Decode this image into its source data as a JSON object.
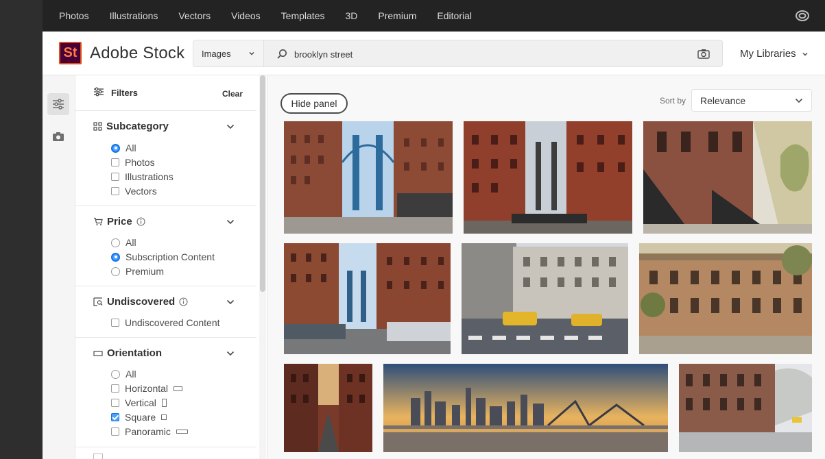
{
  "topnav": {
    "items": [
      "Photos",
      "Illustrations",
      "Vectors",
      "Videos",
      "Templates",
      "3D",
      "Premium",
      "Editorial"
    ],
    "right_icon": "creative-cloud-icon"
  },
  "header": {
    "logo_text": "St",
    "brand": "Adobe Stock",
    "asset_type": "Images",
    "search_value": "brooklyn street",
    "my_libraries": "My Libraries"
  },
  "filters": {
    "title": "Filters",
    "clear": "Clear",
    "sections": {
      "subcategory": {
        "title": "Subcategory",
        "options": [
          {
            "label": "All",
            "control": "radio",
            "selected": true
          },
          {
            "label": "Photos",
            "control": "checkbox",
            "selected": false
          },
          {
            "label": "Illustrations",
            "control": "checkbox",
            "selected": false
          },
          {
            "label": "Vectors",
            "control": "checkbox",
            "selected": false
          }
        ]
      },
      "price": {
        "title": "Price",
        "options": [
          {
            "label": "All",
            "control": "radio",
            "selected": false
          },
          {
            "label": "Subscription Content",
            "control": "radio",
            "selected": true
          },
          {
            "label": "Premium",
            "control": "radio",
            "selected": false
          }
        ]
      },
      "undiscovered": {
        "title": "Undiscovered",
        "options": [
          {
            "label": "Undiscovered Content",
            "control": "checkbox",
            "selected": false
          }
        ]
      },
      "orientation": {
        "title": "Orientation",
        "options": [
          {
            "label": "All",
            "control": "radio",
            "selected": false
          },
          {
            "label": "Horizontal",
            "control": "checkbox",
            "selected": false
          },
          {
            "label": "Vertical",
            "control": "checkbox",
            "selected": false
          },
          {
            "label": "Square",
            "control": "checkbox",
            "selected": true
          },
          {
            "label": "Panoramic",
            "control": "checkbox",
            "selected": false
          }
        ]
      }
    }
  },
  "results": {
    "hide_panel": "Hide panel",
    "sort_label": "Sort by",
    "sort_value": "Relevance"
  },
  "colors": {
    "topnav_bg": "#232323",
    "accent_blue": "#1473e6",
    "logo_bg": "#470137",
    "logo_border": "#e14f1c"
  }
}
